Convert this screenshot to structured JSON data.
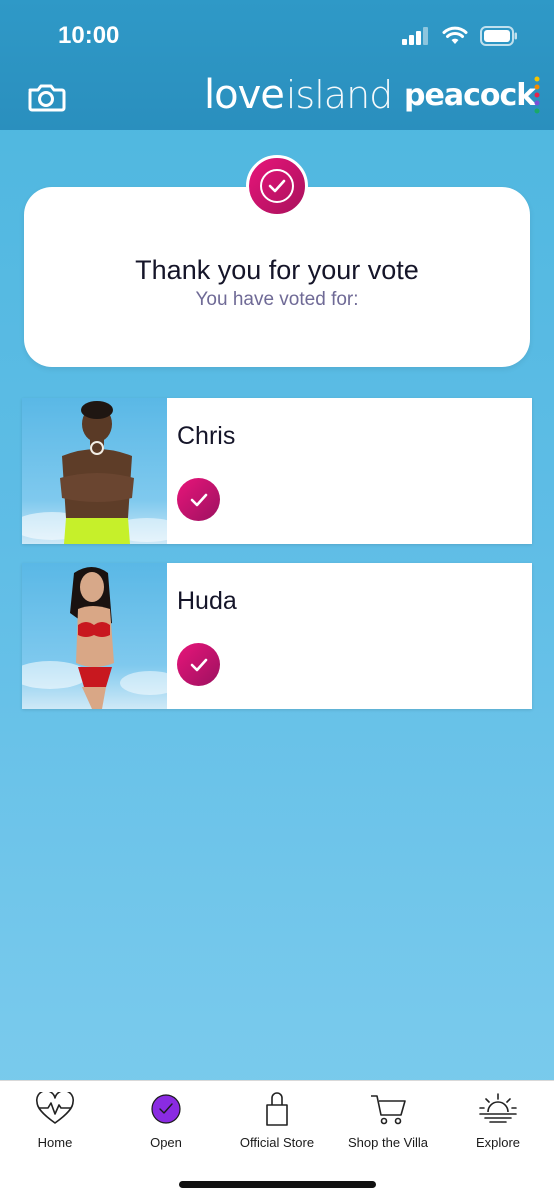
{
  "status_bar": {
    "time": "10:00",
    "icons": [
      "cellular-signal-icon",
      "wifi-icon",
      "battery-icon"
    ]
  },
  "header": {
    "brand_love": "love",
    "brand_island": "island",
    "partner_logo": "peacock",
    "left_button_icon": "camera-icon"
  },
  "confirmation": {
    "title": "Thank you for your vote",
    "subtitle": "You have voted for:",
    "badge_icon": "check-circle-icon"
  },
  "votes": [
    {
      "name": "Chris",
      "selected": true
    },
    {
      "name": "Huda",
      "selected": true
    }
  ],
  "tabs": [
    {
      "label": "Home",
      "icon": "heart-pulse-icon"
    },
    {
      "label": "Open",
      "icon": "vote-check-icon",
      "active": true
    },
    {
      "label": "Official Store",
      "icon": "shopping-bag-icon"
    },
    {
      "label": "Shop the Villa",
      "icon": "shopping-cart-icon"
    },
    {
      "label": "Explore",
      "icon": "sunrise-icon"
    }
  ],
  "colors": {
    "header": "#2a8fbe",
    "background": "#5fbde6",
    "accent": "#e8147a",
    "open_tab": "#8a2be2"
  }
}
